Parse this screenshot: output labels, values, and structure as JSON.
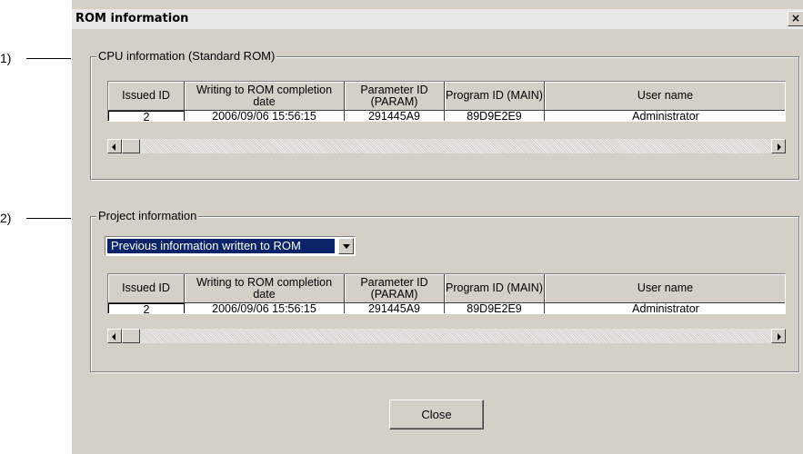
{
  "callouts": [
    "1)",
    "2)"
  ],
  "dialog": {
    "title": "ROM information",
    "close_glyph": "×"
  },
  "cpu_group": {
    "legend": "CPU information (Standard ROM)",
    "columns": [
      "Issued ID",
      "Writing to ROM completion date",
      "Parameter ID (PARAM)",
      "Program ID (MAIN)",
      "User name"
    ],
    "row": [
      "2",
      "2006/09/06 15:56:15",
      "291445A9",
      "89D9E2E9",
      "Administrator"
    ]
  },
  "project_group": {
    "legend": "Project information",
    "combo_value": "Previous information written to ROM",
    "columns": [
      "Issued ID",
      "Writing to ROM completion date",
      "Parameter ID (PARAM)",
      "Program ID (MAIN)",
      "User name"
    ],
    "row": [
      "2",
      "2006/09/06 15:56:15",
      "291445A9",
      "89D9E2E9",
      "Administrator"
    ]
  },
  "close_button": "Close"
}
